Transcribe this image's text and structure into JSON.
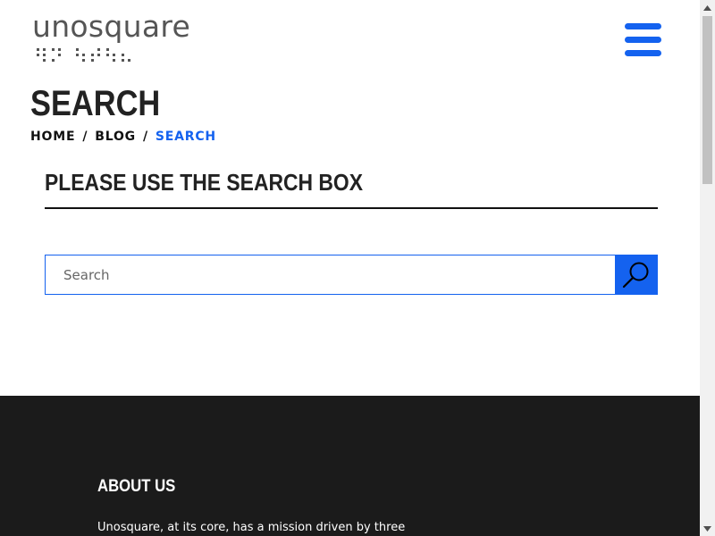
{
  "header": {
    "logo_text": "unosquare",
    "menu_icon": "hamburger-menu-icon",
    "accent_color": "#1462ef"
  },
  "page": {
    "title": "SEARCH",
    "breadcrumb": {
      "items": [
        "HOME",
        "BLOG"
      ],
      "current": "SEARCH",
      "separator": "/"
    }
  },
  "search_section": {
    "heading": "PLEASE USE THE SEARCH BOX",
    "input_placeholder": "Search",
    "input_value": "",
    "button_icon": "search-icon"
  },
  "footer": {
    "heading": "ABOUT US",
    "text": "Unosquare, at its core, has a mission driven by three",
    "background_color": "#1b1b1b"
  }
}
